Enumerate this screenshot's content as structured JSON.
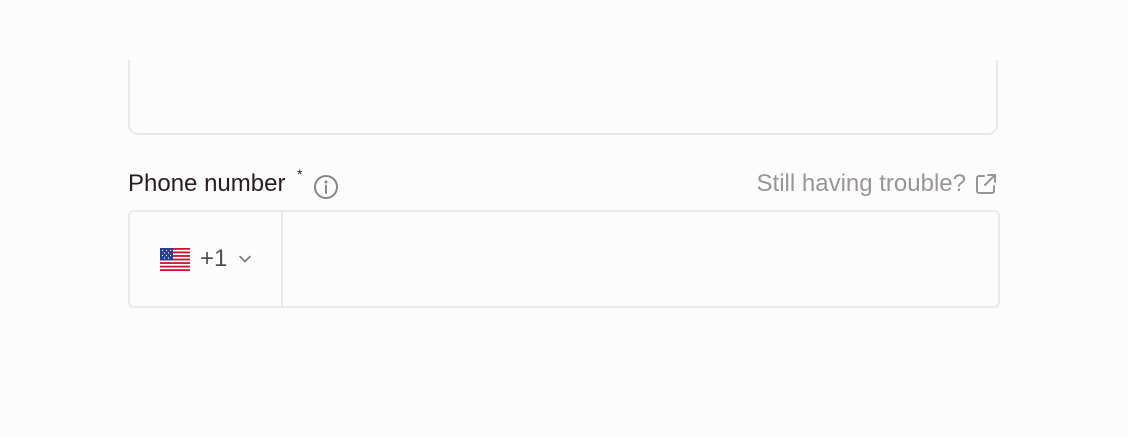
{
  "phone": {
    "label": "Phone number",
    "required_mark": "*",
    "help_link": "Still having trouble?",
    "country": {
      "flag_icon": "us-flag-icon",
      "dial_code": "+1"
    },
    "input_value": "",
    "input_placeholder": ""
  },
  "colors": {
    "label": "#2a1d1d",
    "muted": "#9a9595",
    "border": "#ebe8e8",
    "background": "#fdfcfc"
  }
}
